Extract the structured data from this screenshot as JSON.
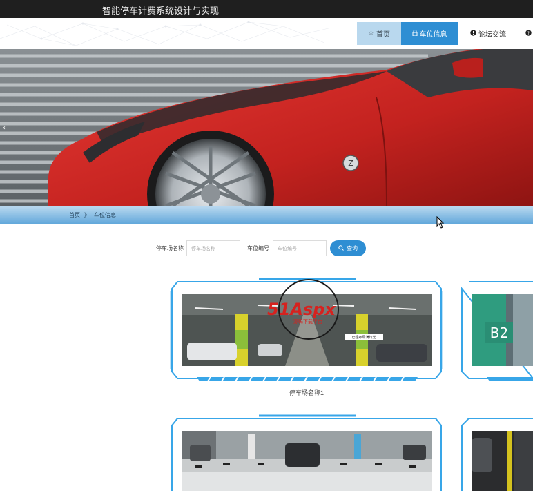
{
  "app": {
    "title": "智能停车计费系统设计与实现"
  },
  "nav": {
    "items": [
      {
        "label": "首页",
        "icon": "star-icon"
      },
      {
        "label": "车位信息",
        "icon": "lock-icon"
      },
      {
        "label": "论坛交流",
        "icon": "info-icon"
      },
      {
        "label": "",
        "icon": "help-icon"
      }
    ]
  },
  "breadcrumb": {
    "home": "首页",
    "separator": "》",
    "current": "车位信息"
  },
  "search": {
    "lot_label": "停车场名称",
    "lot_placeholder": "停车场名称",
    "space_label": "车位编号",
    "space_placeholder": "车位编号",
    "button": "查询"
  },
  "cards": [
    {
      "caption": "停车场名称1",
      "photo_sign": "已经布局满灯光"
    },
    {
      "caption": "",
      "photo_sign": "B2"
    },
    {
      "caption": "",
      "photo_sign": ""
    },
    {
      "caption": "",
      "photo_sign": ""
    }
  ],
  "watermark": {
    "brand": "51Aspx",
    "sub": "源码下载平台"
  },
  "colors": {
    "accent": "#2e8ed3",
    "topbar": "#1f1f1f",
    "frame": "#38a6e8"
  }
}
